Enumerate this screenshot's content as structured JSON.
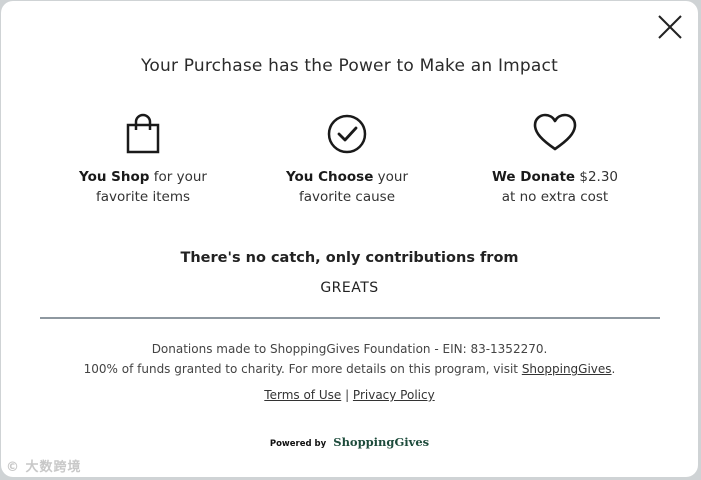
{
  "modal": {
    "title": "Your Purchase has the Power to Make an Impact",
    "close_icon": "close-icon"
  },
  "features": [
    {
      "icon": "shopping-bag-icon",
      "bold": "You Shop",
      "rest": " for your favorite items"
    },
    {
      "icon": "check-circle-icon",
      "bold": "You Choose",
      "rest": " your favorite cause"
    },
    {
      "icon": "heart-icon",
      "bold": "We Donate",
      "rest": " $2.30 at no extra cost"
    }
  ],
  "catch_text": "There's no catch, only contributions from",
  "merchant": "GREATS",
  "footer": {
    "line1": "Donations made to ShoppingGives Foundation - EIN: 83-1352270.",
    "line2_prefix": "100% of funds granted to charity. For more details on this program, visit ",
    "line2_link": "ShoppingGives",
    "line2_suffix": ".",
    "terms": "Terms of Use",
    "separator": " | ",
    "privacy": "Privacy Policy"
  },
  "powered": {
    "label": "Powered by",
    "brand": "ShoppingGives"
  },
  "watermark": "© 大数跨境"
}
